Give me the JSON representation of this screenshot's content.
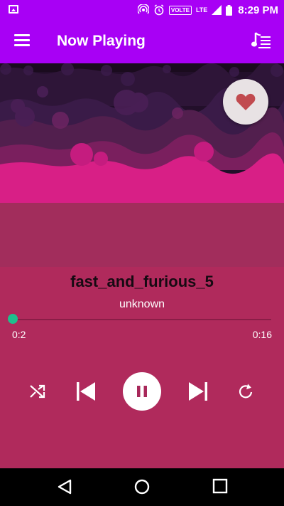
{
  "status_bar": {
    "time": "8:29",
    "ampm": "PM",
    "network_label": "VOLTE",
    "lte_label": "LTE",
    "icons": [
      "gallery-icon",
      "hotspot-icon",
      "alarm-icon",
      "volte-badge",
      "signal-icon",
      "battery-icon"
    ]
  },
  "app_bar": {
    "title": "Now Playing",
    "menu_icon": "menu-icon",
    "queue_icon": "playlist-icon",
    "background": "#a800f5"
  },
  "album_art": {
    "favorite_icon": "heart-icon",
    "favorite_color": "#c14a4f"
  },
  "track": {
    "title": "fast_and_furious_5",
    "artist": "unknown"
  },
  "progress": {
    "current": "0:2",
    "total": "0:16",
    "fraction": 0.0,
    "accent": "#1fbf8d"
  },
  "controls": {
    "shuffle_icon": "shuffle-icon",
    "previous_icon": "skip-previous-icon",
    "play_pause_icon": "pause-icon",
    "next_icon": "skip-next-icon",
    "repeat_icon": "repeat-icon"
  },
  "nav_bar": {
    "back_icon": "back-icon",
    "home_icon": "home-icon",
    "recents_icon": "recents-icon"
  }
}
